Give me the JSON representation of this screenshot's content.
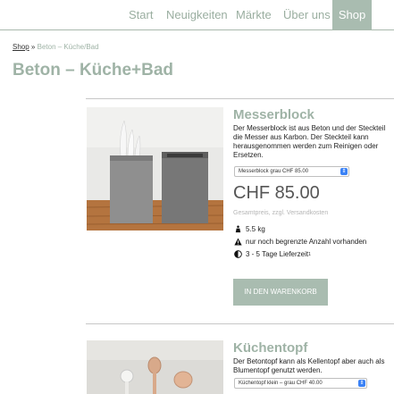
{
  "nav": {
    "items": [
      {
        "label": "Start",
        "active": false
      },
      {
        "label": "Neuigkeiten",
        "active": false
      },
      {
        "label": "Märkte",
        "active": false
      },
      {
        "label": "Über uns",
        "active": false
      },
      {
        "label": "Shop",
        "active": true
      }
    ]
  },
  "breadcrumb": {
    "root": "Shop",
    "separator": "»",
    "current": "Beton – Küche/Bad"
  },
  "page": {
    "title": "Beton – Küche+Bad"
  },
  "products": [
    {
      "title": "Messerblock",
      "description": "Der Messerblock ist aus Beton und der Steckteil die Messer aus Karbon. Der Steckteil kann herausgenommen werden zum Reinigen oder Ersetzen.",
      "variant": "Messerblock grau CHF 85.00",
      "price": "CHF 85.00",
      "price_note": "Gesamtpreis, zzgl. Versandkosten",
      "weight": "5.5 kg",
      "stock": "nur noch begrenzte Anzahl vorhanden",
      "delivery": "3 - 5 Tage Lieferzeit",
      "delivery_footnote": "1",
      "cart_button": "IN DEN WARENKORB"
    },
    {
      "title": "Küchentopf",
      "description": "Der Betontopf kann als Kellentopf aber auch als Blumentopf genutzt werden.",
      "variant": "Küchentopf klein – grau CHF 40.00"
    }
  ],
  "colors": {
    "accent": "#a9bcb0",
    "title": "#9fb3a6",
    "select_arrow": "#3b82f6"
  }
}
